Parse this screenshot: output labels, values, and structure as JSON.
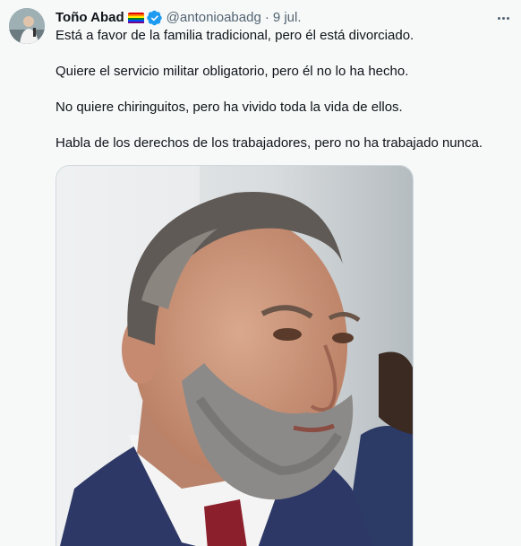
{
  "tweet": {
    "author": {
      "display_name": "Toño Abad",
      "handle": "@antonioabadg",
      "flag_icon": "rainbow-flag-icon",
      "verified_icon": "verified-badge-icon",
      "avatar_icon": "avatar"
    },
    "separator": "·",
    "date": "9 jul.",
    "more_icon": "more-icon",
    "lines": [
      "Está a favor de la familia tradicional, pero él está divorciado.",
      "Quiere el servicio militar obligatorio, pero él no lo ha hecho.",
      "No quiere chiringuitos, pero ha vivido toda la vida de ellos.",
      "Habla de los derechos de los trabajadores, pero no ha trabajado nunca."
    ],
    "media": {
      "alt_icon": "photo-of-bearded-man-in-suit"
    }
  },
  "colors": {
    "text": "#0f1419",
    "secondary": "#536471",
    "background": "#f7f9f9",
    "verified": "#1d9bf0"
  }
}
